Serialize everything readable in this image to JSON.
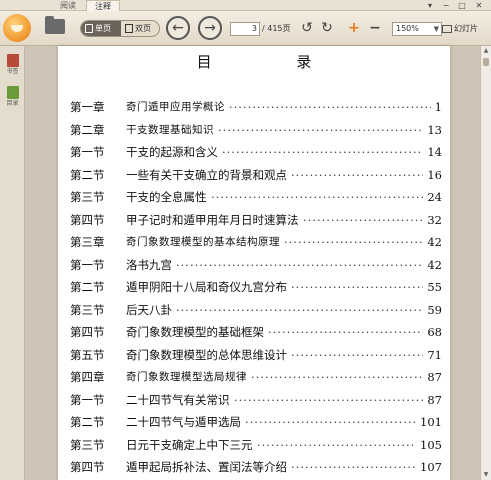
{
  "tabs": [
    {
      "label": "阅读"
    },
    {
      "label": "注释"
    }
  ],
  "window_controls": {
    "menu": "▾",
    "minimize": "−",
    "maximize": "□",
    "close": "✕"
  },
  "toolbar": {
    "view_single": "单页",
    "view_double": "双页",
    "current_page": "3",
    "total_pages": "/ 415页",
    "zoom": "150%",
    "slideshow": "幻灯片",
    "icons": [
      "logo-icon",
      "open-folder-icon",
      "prev-page-icon",
      "next-page-icon",
      "rotate-left-icon",
      "rotate-right-icon",
      "zoom-in-icon",
      "zoom-out-icon"
    ]
  },
  "sidebar": {
    "items": [
      {
        "label": "书签",
        "color": "#b84a3a"
      },
      {
        "label": "目录",
        "color": "#6a9a3a"
      }
    ]
  },
  "document": {
    "title": "目    录",
    "toc": [
      {
        "label": "第一章",
        "title": "奇门遁甲应用学概论",
        "page": "1",
        "chapter": true
      },
      {
        "label": "第二章",
        "title": "干支数理基础知识",
        "page": "13",
        "chapter": true
      },
      {
        "label": "第一节",
        "title": "干支的起源和含义",
        "page": "14",
        "chapter": false
      },
      {
        "label": "第二节",
        "title": "一些有关干支确立的背景和观点",
        "page": "16",
        "chapter": false
      },
      {
        "label": "第三节",
        "title": "干支的全息属性",
        "page": "24",
        "chapter": false
      },
      {
        "label": "第四节",
        "title": "甲子记时和遁甲用年月日时速算法",
        "page": "32",
        "chapter": false
      },
      {
        "label": "第三章",
        "title": "奇门象数理模型的基本结构原理",
        "page": "42",
        "chapter": true
      },
      {
        "label": "第一节",
        "title": "洛书九宫",
        "page": "42",
        "chapter": false
      },
      {
        "label": "第二节",
        "title": "遁甲阴阳十八局和奇仪九宫分布",
        "page": "55",
        "chapter": false
      },
      {
        "label": "第三节",
        "title": "后天八卦",
        "page": "59",
        "chapter": false
      },
      {
        "label": "第四节",
        "title": "奇门象数理模型的基础框架",
        "page": "68",
        "chapter": false
      },
      {
        "label": "第五节",
        "title": "奇门象数理模型的总体思维设计",
        "page": "71",
        "chapter": false
      },
      {
        "label": "第四章",
        "title": "奇门象数理模型选局规律",
        "page": "87",
        "chapter": true
      },
      {
        "label": "第一节",
        "title": "二十四节气有关常识",
        "page": "87",
        "chapter": false
      },
      {
        "label": "第二节",
        "title": "二十四节气与遁甲选局",
        "page": "101",
        "chapter": false
      },
      {
        "label": "第三节",
        "title": "日元干支确定上中下三元",
        "page": "105",
        "chapter": false
      },
      {
        "label": "第四节",
        "title": "遁甲起局拆补法、置闰法等介绍",
        "page": "107",
        "chapter": false
      }
    ]
  }
}
